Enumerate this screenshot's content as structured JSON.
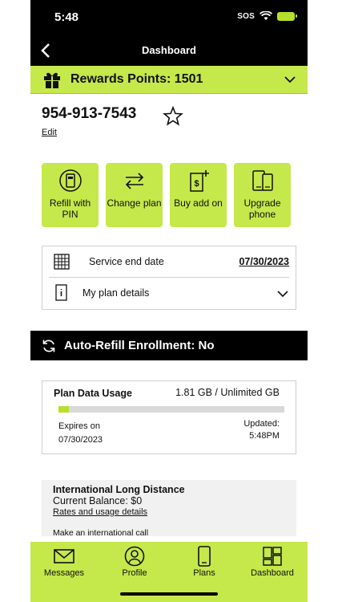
{
  "status_bar": {
    "time": "5:48",
    "carrier": "SOS"
  },
  "nav": {
    "title": "Dashboard"
  },
  "rewards": {
    "text": "Rewards Points: 1501"
  },
  "account": {
    "phone_number": "954-913-7543",
    "edit_label": "Edit"
  },
  "actions": [
    {
      "label": "Refill with PIN",
      "icon": "refill-card-icon"
    },
    {
      "label": "Change plan",
      "icon": "swap-arrows-icon"
    },
    {
      "label": "Buy add on",
      "icon": "add-on-icon"
    },
    {
      "label": "Upgrade phone",
      "icon": "phones-icon"
    }
  ],
  "service": {
    "end_date_label": "Service end date",
    "end_date_value": "07/30/2023",
    "plan_details_label": "My plan details"
  },
  "auto_refill": {
    "text": "Auto-Refill Enrollment:  No"
  },
  "usage": {
    "title": "Plan Data Usage",
    "amount": "1.81 GB / Unlimited GB",
    "used_fraction": 0.045,
    "expires_label": "Expires on",
    "expires_date": "07/30/2023",
    "updated_label": "Updated:",
    "updated_time": "5:48PM"
  },
  "international": {
    "title": "International Long Distance",
    "balance": "Current Balance: $0",
    "rates_link": "Rates and usage details",
    "call_link": "Make an international call"
  },
  "tabs": [
    {
      "label": "Messages",
      "icon": "envelope-icon"
    },
    {
      "label": "Profile",
      "icon": "user-circle-icon"
    },
    {
      "label": "Plans",
      "icon": "phone-device-icon"
    },
    {
      "label": "Dashboard",
      "icon": "dashboard-grid-icon"
    }
  ],
  "colors": {
    "accent": "#c5e84b",
    "dark": "#000000"
  }
}
